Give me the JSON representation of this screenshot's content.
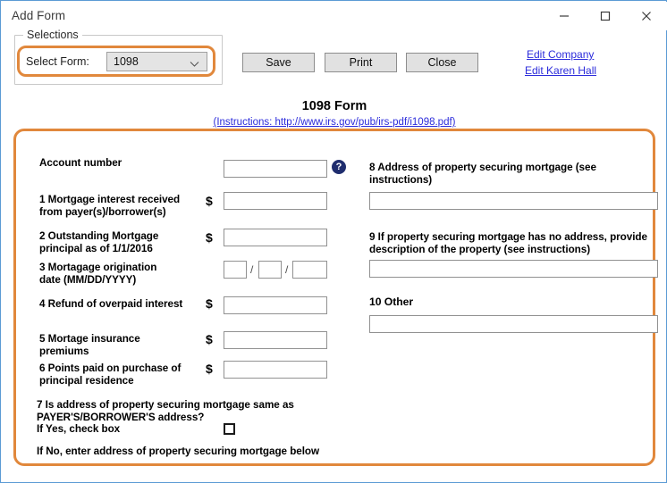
{
  "window": {
    "title": "Add Form",
    "controls": {
      "minimize": "minimize-icon",
      "maximize": "maximize-icon",
      "close": "close-icon"
    }
  },
  "selections": {
    "group_label": "Selections",
    "select_form_label": "Select Form:",
    "select_form_value": "1098",
    "chevron": "chevron-down-icon"
  },
  "toolbar": {
    "save_label": "Save",
    "print_label": "Print",
    "close_label": "Close",
    "edit_company_link": "Edit Company",
    "edit_person_link": "Edit Karen Hall"
  },
  "form": {
    "title": "1098 Form",
    "instructions_text": "(Instructions: http://www.irs.gov/pub/irs-pdf/i1098.pdf)",
    "help_icon_glyph": "?",
    "left_fields": {
      "account_number_label": "Account number",
      "account_number_value": "",
      "field1_label_line1": "1 Mortgage interest received",
      "field1_label_line2": "from payer(s)/borrower(s)",
      "field1_currency": "$",
      "field1_value": "",
      "field2_label_line1": "2 Outstanding Mortgage",
      "field2_label_line2": "principal as of  1/1/2016",
      "field2_currency": "$",
      "field2_value": "",
      "field3_label_line1": "3 Mortagage origination",
      "field3_label_line2": "date (MM/DD/YYYY)",
      "field3_month_value": "",
      "field3_day_value": "",
      "field3_year_value": "",
      "field3_separator": "/",
      "field4_label": "4 Refund of overpaid interest",
      "field4_currency": "$",
      "field4_value": "",
      "field5_label_line1": "5 Mortage insurance",
      "field5_label_line2": "premiums",
      "field5_currency": "$",
      "field5_value": "",
      "field6_label_line1": "6 Points paid on purchase of",
      "field6_label_line2": "principal residence",
      "field6_currency": "$",
      "field6_value": "",
      "field7_label_line1": "7 Is address of property securing mortgage same as",
      "field7_label_line2": "PAYER'S/BORROWER'S address?",
      "field7_yes_label": "If Yes, check box",
      "field7_checked": false,
      "field7_no_label": "If No, enter address of property securing mortgage below"
    },
    "right_fields": {
      "field8_label_line1": "8 Address of property securing mortgage (see",
      "field8_label_line2": "instructions)",
      "field8_value": "",
      "field9_label_line1": "9 If property securing mortgage has no address, provide",
      "field9_label_line2": "description of the property (see instructions)",
      "field9_value": "",
      "field10_label": "10 Other",
      "field10_value": ""
    }
  },
  "colors": {
    "accent_orange": "#e1883c",
    "link_blue": "#2b2bdb",
    "window_border_blue": "#5b9bd5",
    "help_icon_navy": "#1f2d6e",
    "button_face": "#e1e1e1"
  }
}
